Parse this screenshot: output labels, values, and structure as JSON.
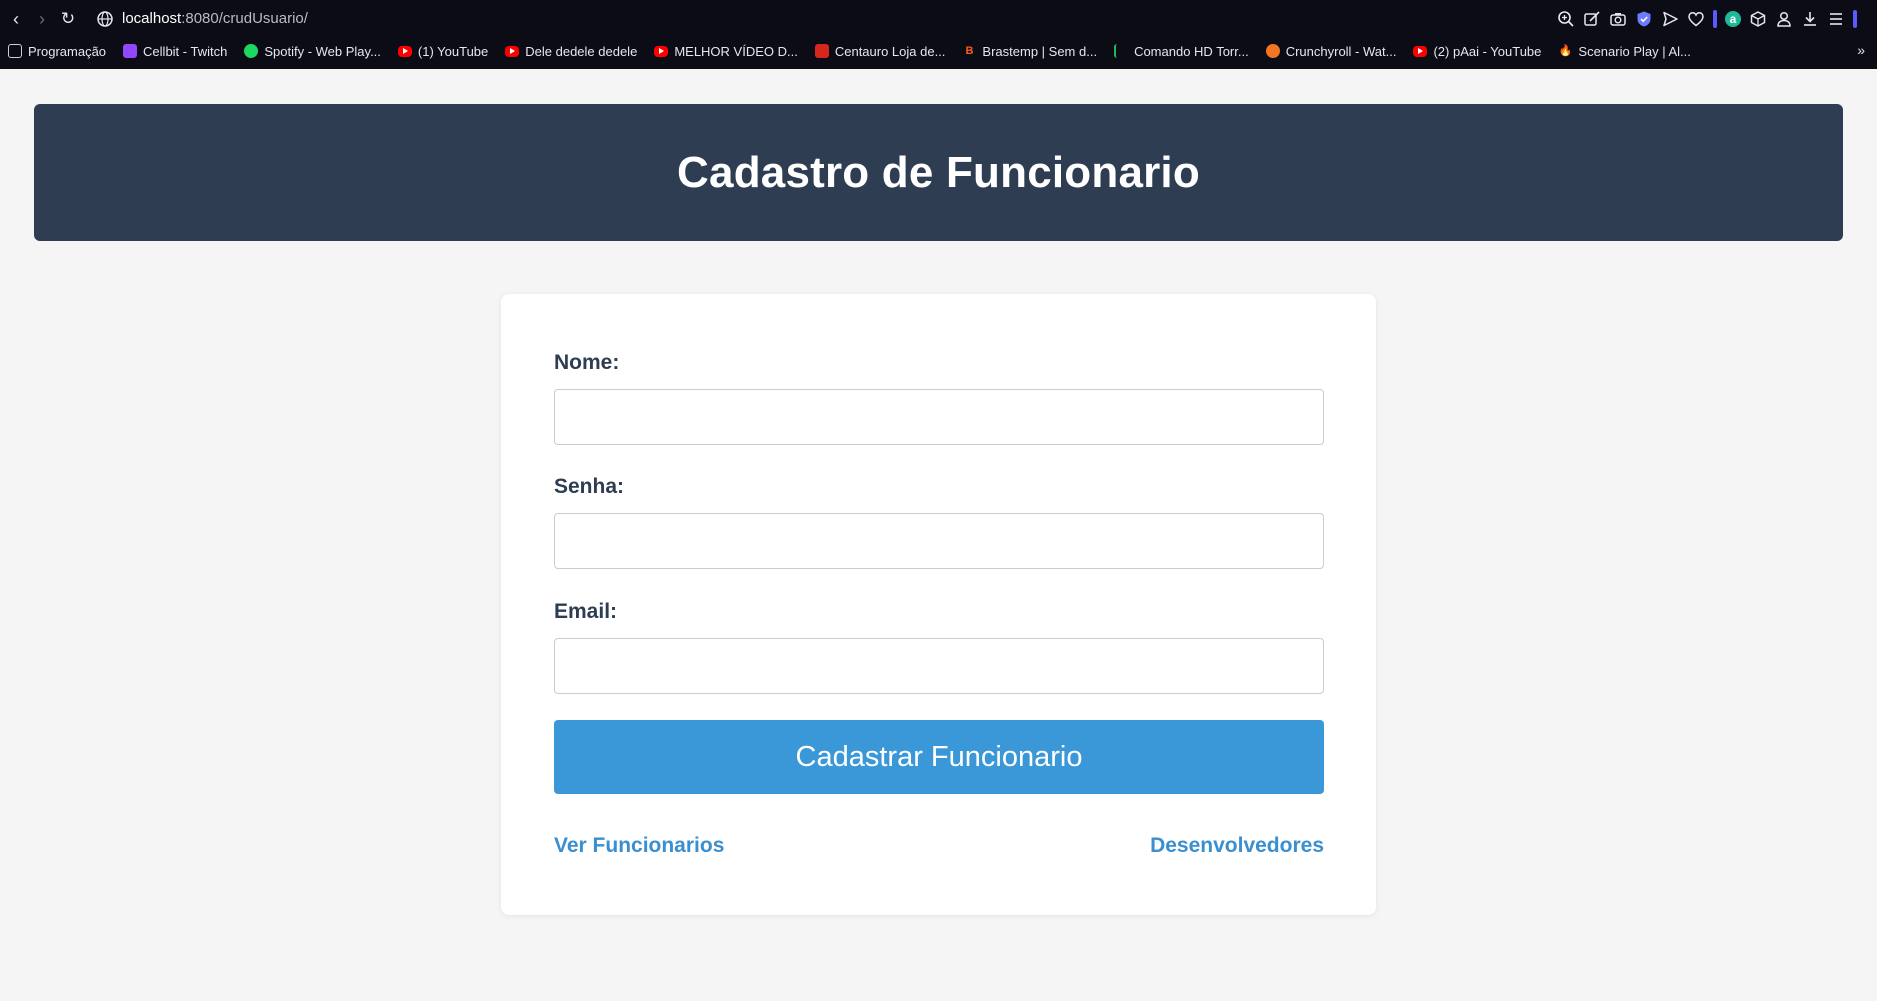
{
  "browser": {
    "url_host": "localhost",
    "url_rest": ":8080/crudUsuario/",
    "bookmarks": [
      {
        "label": "Programação",
        "icon": "folder-icon"
      },
      {
        "label": "Cellbit - Twitch",
        "icon": "twitch-icon"
      },
      {
        "label": "Spotify - Web Play...",
        "icon": "spotify-icon"
      },
      {
        "label": "(1) YouTube",
        "icon": "youtube-icon"
      },
      {
        "label": "Dele dedele dedele",
        "icon": "youtube-icon"
      },
      {
        "label": "MELHOR VÍDEO D...",
        "icon": "youtube-icon"
      },
      {
        "label": "Centauro Loja de...",
        "icon": "centauro-icon"
      },
      {
        "label": "Brastemp | Sem d...",
        "icon": "brastemp-icon"
      },
      {
        "label": "Comando HD Torr...",
        "icon": "comando-icon"
      },
      {
        "label": "Crunchyroll - Wat...",
        "icon": "crunchyroll-icon"
      },
      {
        "label": "(2) pAai - YouTube",
        "icon": "youtube-icon"
      },
      {
        "label": "Scenario Play | Al...",
        "icon": "scenario-icon"
      }
    ],
    "brastemp_glyph": "B",
    "scenario_glyph": "🔥",
    "extension_glyph": "a",
    "colors": {
      "chrome_bg": "#0c0c17",
      "shield": "#6c7cff"
    }
  },
  "header": {
    "title": "Cadastro de Funcionario",
    "bg_color": "#2e3d51"
  },
  "form": {
    "nome_label": "Nome:",
    "nome_value": "",
    "senha_label": "Senha:",
    "senha_value": "",
    "email_label": "Email:",
    "email_value": "",
    "submit_label": "Cadastrar Funcionario",
    "button_color": "#3a97d8"
  },
  "links": {
    "ver_funcionarios": "Ver Funcionarios",
    "desenvolvedores": "Desenvolvedores",
    "link_color": "#3a8fd0"
  }
}
